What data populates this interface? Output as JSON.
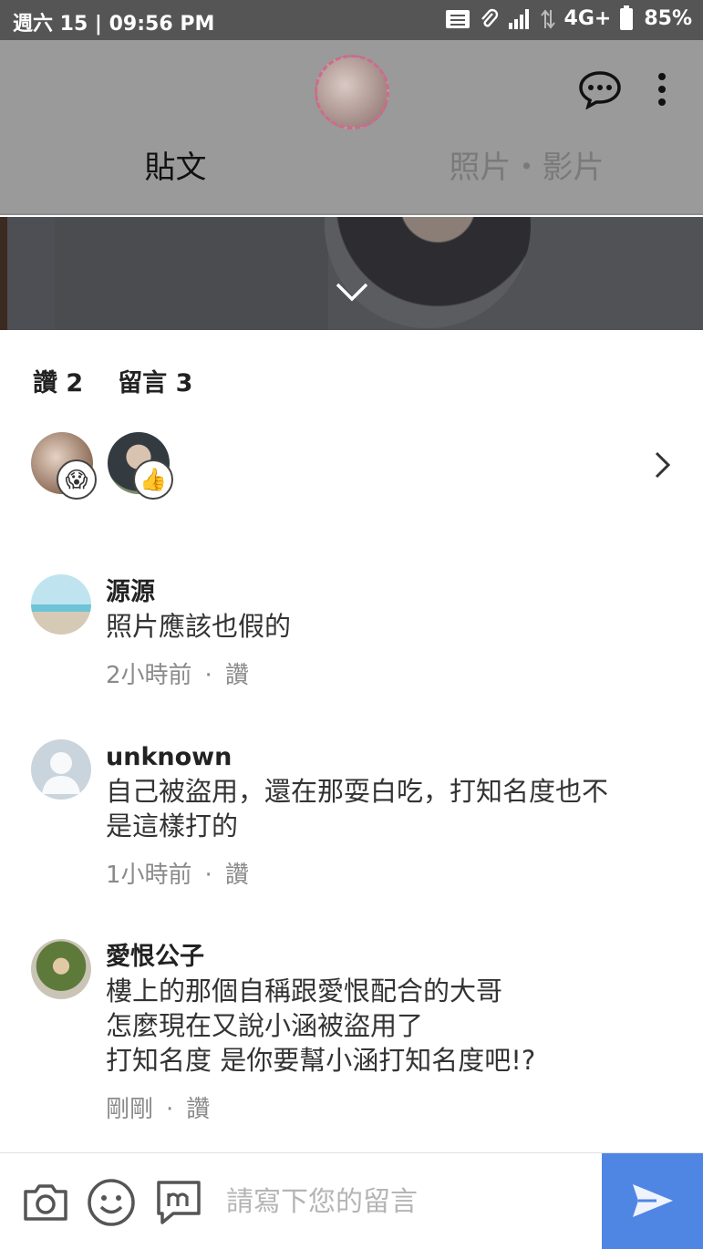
{
  "status_bar": {
    "time": "週六 15 | 09:56 PM",
    "network": "4G+",
    "battery": "85%"
  },
  "header": {
    "tabs": [
      {
        "label": "貼文",
        "active": true
      },
      {
        "label": "照片・影片",
        "active": false
      }
    ]
  },
  "summary": {
    "likes": "讚 2",
    "comments": "留言 3"
  },
  "likers": [
    {
      "reaction": "surprised-icon"
    },
    {
      "reaction": "thumbs-up-icon"
    }
  ],
  "comments": [
    {
      "name": "源源",
      "text": "照片應該也假的",
      "time": "2小時前",
      "like": "讚"
    },
    {
      "name": "unknown",
      "text": "自己被盜用，還在那耍白吃，打知名度也不\n是這樣打的",
      "time": "1小時前",
      "like": "讚"
    },
    {
      "name": "愛恨公子",
      "text": "樓上的那個自稱跟愛恨配合的大哥\n怎麼現在又說小涵被盜用了\n打知名度  是你要幫小涵打知名度吧!?",
      "time": "剛剛",
      "like": "讚"
    }
  ],
  "composer": {
    "placeholder": "請寫下您的留言"
  },
  "colors": {
    "send_button": "#4f86e3",
    "status_bar": "#555555",
    "header_dim": "#9a9a9a"
  }
}
